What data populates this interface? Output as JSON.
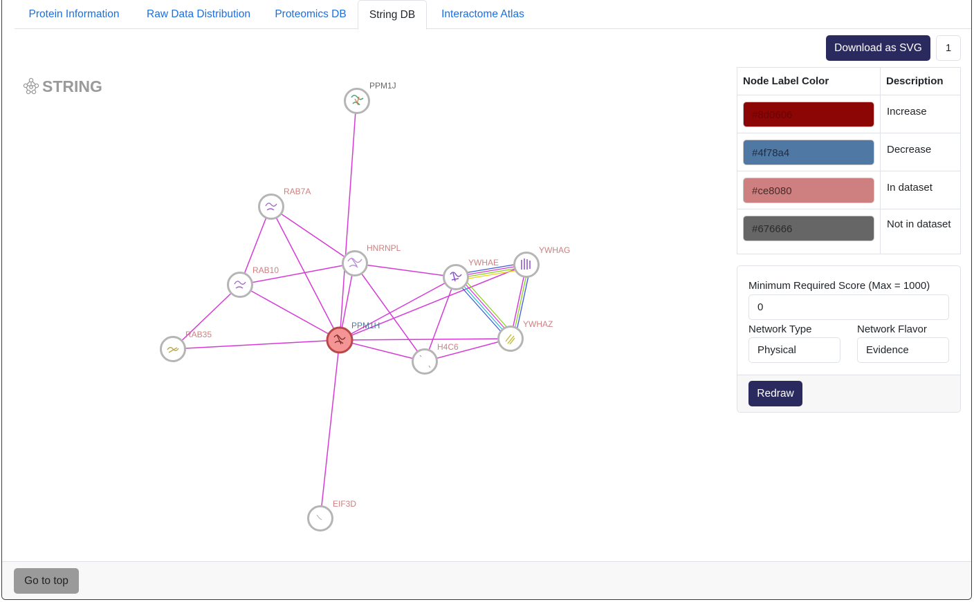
{
  "tabs": [
    {
      "label": "Protein Information"
    },
    {
      "label": "Raw Data Distribution"
    },
    {
      "label": "Proteomics DB"
    },
    {
      "label": "String DB"
    },
    {
      "label": "Interactome Atlas"
    }
  ],
  "toolbar": {
    "download_label": "Download as SVG",
    "page_number": "1"
  },
  "network": {
    "logo_text": "STRING",
    "nodes": [
      {
        "id": "PPM1J",
        "label": "PPM1J",
        "category": "Not in dataset"
      },
      {
        "id": "RAB7A",
        "label": "RAB7A",
        "category": "In dataset"
      },
      {
        "id": "HNRNPL",
        "label": "HNRNPL",
        "category": "In dataset"
      },
      {
        "id": "RAB10",
        "label": "RAB10",
        "category": "In dataset"
      },
      {
        "id": "YWHAE",
        "label": "YWHAE",
        "category": "In dataset"
      },
      {
        "id": "YWHAG",
        "label": "YWHAG",
        "category": "In dataset"
      },
      {
        "id": "PPM1H",
        "label": "PPM1H",
        "category": "Decrease"
      },
      {
        "id": "YWHAZ",
        "label": "YWHAZ",
        "category": "In dataset"
      },
      {
        "id": "RAB35",
        "label": "RAB35",
        "category": "In dataset"
      },
      {
        "id": "H4C6",
        "label": "H4C6",
        "category": "In dataset"
      },
      {
        "id": "EIF3D",
        "label": "EIF3D",
        "category": "In dataset"
      }
    ]
  },
  "legend": {
    "header_color": "Node Label Color",
    "header_desc": "Description",
    "rows": [
      {
        "hex": "#8d0606",
        "desc": "Increase"
      },
      {
        "hex": "#4f78a4",
        "desc": "Decrease"
      },
      {
        "hex": "#ce8080",
        "desc": "In dataset"
      },
      {
        "hex": "#676666",
        "desc": "Not in dataset"
      }
    ]
  },
  "controls": {
    "min_score_label": "Minimum Required Score (Max = 1000)",
    "min_score_value": "0",
    "network_type_label": "Network Type",
    "network_type_value": "Physical",
    "network_flavor_label": "Network Flavor",
    "network_flavor_value": "Evidence",
    "redraw_label": "Redraw"
  },
  "footer": {
    "go_top_label": "Go to top"
  },
  "colors": {
    "accent": "#2b2a5e",
    "link": "#1a6fe0",
    "edge": "#d63ad6",
    "query_node_fill": "#f59494",
    "query_node_stroke": "#b84848"
  }
}
